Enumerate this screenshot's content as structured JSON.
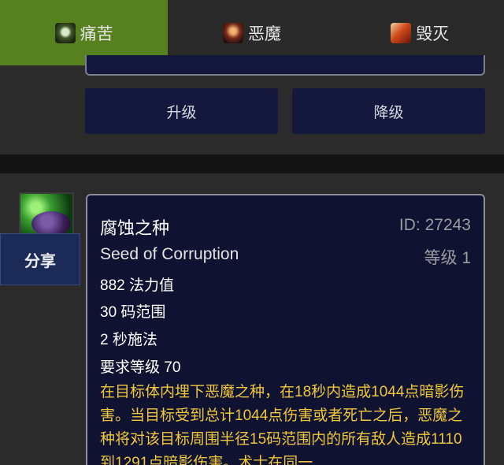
{
  "tabs": [
    {
      "label": "痛苦",
      "icon": "affliction-icon",
      "active": true
    },
    {
      "label": "恶魔",
      "icon": "demonology-icon",
      "active": false
    },
    {
      "label": "毁灭",
      "icon": "destruction-icon",
      "active": false
    }
  ],
  "buttons": {
    "upgrade": "升级",
    "downgrade": "降级"
  },
  "share_label": "分享",
  "spell": {
    "name_cn": "腐蚀之种",
    "id_text": "ID: 27243",
    "name_en": "Seed of Corruption",
    "rank": "等级 1",
    "stats": [
      "882 法力值",
      "30 码范围",
      "2 秒施法",
      "要求等级 70"
    ],
    "description": "在目标体内埋下恶魔之种，在18秒内造成1044点暗影伤害。当目标受到总计1044点伤害或者死亡之后，恶魔之种将对该目标周围半径15码范围内的所有敌人造成1110到1291点暗影伤害。术士在同一"
  },
  "colors": {
    "active_tab": "#57801e",
    "panel": "#0f1231",
    "description_text": "#f0c63c",
    "muted_text": "#9b9ba2"
  }
}
